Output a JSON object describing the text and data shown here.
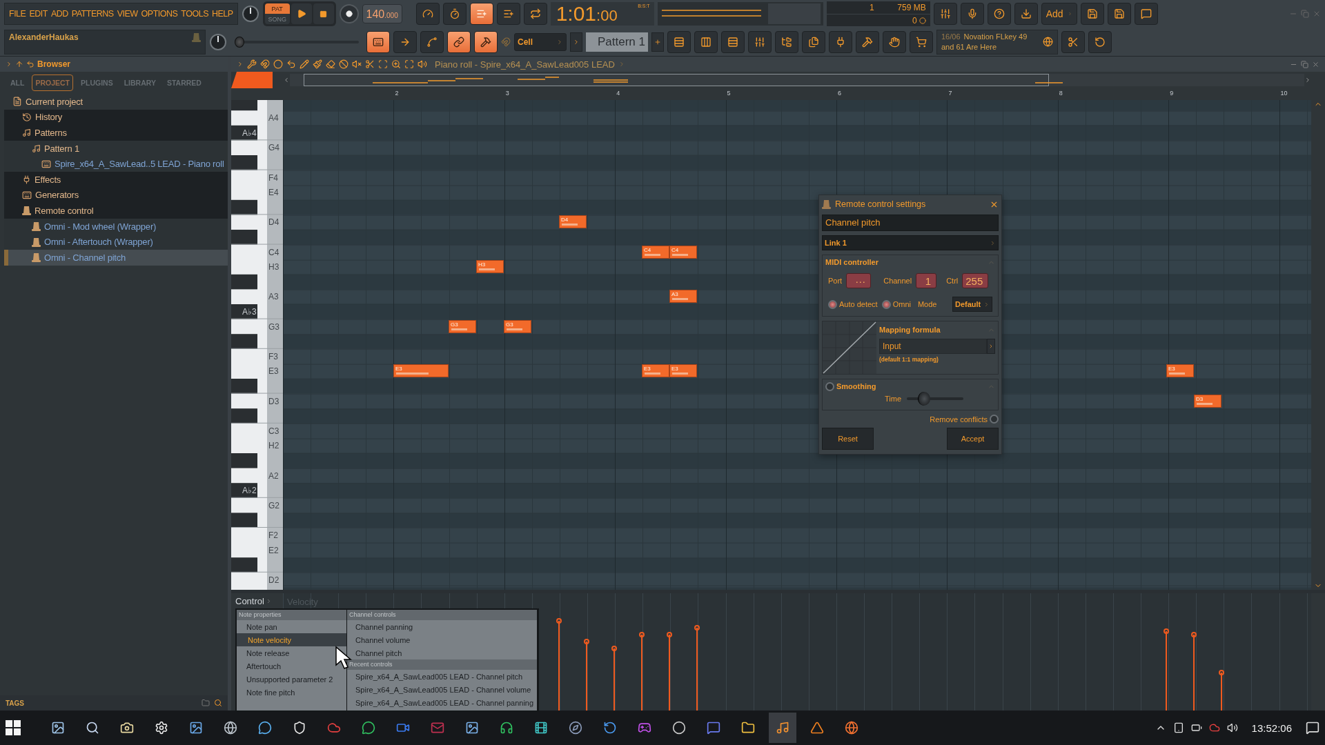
{
  "menu": [
    "FILE",
    "EDIT",
    "ADD",
    "PATTERNS",
    "VIEW",
    "OPTIONS",
    "TOOLS",
    "HELP"
  ],
  "hint_bar": {
    "text": "AlexanderHaukas"
  },
  "transport": {
    "modes": [
      {
        "label": "PAT",
        "selected": true
      },
      {
        "label": "SONG",
        "selected": false
      }
    ],
    "tempo": "140",
    "tempo_fraction": ".000"
  },
  "recording_toggles": [
    {
      "on": false
    },
    {
      "on": false
    },
    {
      "on": true
    },
    {
      "on": false
    },
    {
      "on": false
    }
  ],
  "time": {
    "value": "1:01",
    "ticks": ":00",
    "unit": "B:S:T"
  },
  "monitor": {
    "value": "1",
    "memory": "759 MB",
    "polyphony": "0"
  },
  "add_button": "Add",
  "master_pitch": {
    "level": 0
  },
  "tool_toggles": [
    {
      "on": true
    },
    {
      "on": false
    },
    {
      "on": false
    },
    {
      "on": true
    },
    {
      "on": true
    }
  ],
  "snap": "Cell",
  "pattern": "Pattern 1",
  "news": {
    "date": "16/06",
    "text": "Novation FLkey 49 and 61 Are Here"
  },
  "browser": {
    "title": "Browser",
    "tabs": [
      {
        "label": "ALL",
        "selected": false
      },
      {
        "label": "PROJECT",
        "selected": true
      },
      {
        "label": "PLUGINS",
        "selected": false
      },
      {
        "label": "LIBRARY",
        "selected": false
      },
      {
        "label": "STARRED",
        "selected": false
      }
    ],
    "tree": [
      {
        "label": "Current project",
        "kind": "doc",
        "selected": false,
        "children": [
          {
            "label": "History",
            "kind": "history",
            "selected": false
          },
          {
            "label": "Patterns",
            "kind": "note",
            "selected": false,
            "children": [
              {
                "label": "Pattern 1",
                "kind": "note",
                "selected": false,
                "children": [
                  {
                    "label": "Spire_x64_A_SawLead..5 LEAD - Piano roll",
                    "kind": "piano-item",
                    "selected": false
                  }
                ]
              }
            ]
          },
          {
            "label": "Effects",
            "kind": "effect",
            "selected": false
          },
          {
            "label": "Generators",
            "kind": "piano",
            "selected": false
          },
          {
            "label": "Remote control",
            "kind": "knob",
            "selected": false,
            "children": [
              {
                "label": "Omni - Mod wheel (Wrapper)",
                "kind": "knob-item",
                "selected": false
              },
              {
                "label": "Omni - Aftertouch (Wrapper)",
                "kind": "knob-item",
                "selected": false
              },
              {
                "label": "Omni - Channel pitch",
                "kind": "knob-item",
                "selected": true
              }
            ]
          }
        ]
      }
    ],
    "tags": "TAGS"
  },
  "piano_roll": {
    "title": "Piano roll - Spire_x64_A_SawLead005 LEAD",
    "bars": [
      "2",
      "3",
      "4",
      "5",
      "6",
      "7",
      "8",
      "9",
      "10"
    ],
    "keys": [
      {
        "label": "A4",
        "kind": "white"
      },
      {
        "label": "A♭4",
        "kind": "black"
      },
      {
        "label": "G4",
        "kind": "white"
      },
      {
        "label": "F4",
        "kind": "white"
      },
      {
        "label": "E4",
        "kind": "white"
      },
      {
        "label": "D4",
        "kind": "white"
      },
      {
        "label": "C4",
        "kind": "white"
      },
      {
        "label": "H3",
        "kind": "white"
      },
      {
        "label": "A3",
        "kind": "white"
      },
      {
        "label": "A♭3",
        "kind": "black"
      },
      {
        "label": "G3",
        "kind": "white"
      },
      {
        "label": "F3",
        "kind": "white"
      },
      {
        "label": "E3",
        "kind": "white"
      },
      {
        "label": "D3",
        "kind": "white"
      },
      {
        "label": "C3",
        "kind": "white"
      },
      {
        "label": "H2",
        "kind": "white"
      },
      {
        "label": "A2",
        "kind": "white"
      },
      {
        "label": "A♭2",
        "kind": "black"
      },
      {
        "label": "G2",
        "kind": "white"
      },
      {
        "label": "F2",
        "kind": "white"
      },
      {
        "label": "E2",
        "kind": "white"
      },
      {
        "label": "D2",
        "kind": "white"
      }
    ],
    "notes": [
      {
        "label": "E3"
      },
      {
        "label": "G3"
      },
      {
        "label": "G3"
      },
      {
        "label": "H3"
      },
      {
        "label": "D4"
      },
      {
        "label": "C4"
      },
      {
        "label": "C4"
      },
      {
        "label": "A3"
      },
      {
        "label": "E3"
      },
      {
        "label": "E3"
      },
      {
        "label": "E3"
      },
      {
        "label": "D3"
      }
    ]
  },
  "remote_dialog": {
    "title": "Remote control settings",
    "name": "Channel pitch",
    "link": "Link 1",
    "midi": {
      "title": "MIDI controller",
      "port_label": "Port",
      "port": "···",
      "channel_label": "Channel",
      "channel": "1",
      "ctrl_label": "Ctrl",
      "ctrl": "255",
      "options": [
        {
          "label": "Auto detect",
          "checked": true
        },
        {
          "label": "Omni",
          "checked": true
        }
      ],
      "mode_label": "Mode",
      "mode": "Default"
    },
    "mapping": {
      "title": "Mapping formula",
      "formula": "Input",
      "note": "(default 1:1 mapping)"
    },
    "smoothing": {
      "label": "Smoothing",
      "checked": false,
      "time_label": "Time",
      "level": 0.25
    },
    "remove_conflicts": {
      "label": "Remove conflicts",
      "checked": false
    },
    "buttons": [
      "Reset",
      "Accept"
    ]
  },
  "event_editor": {
    "control": "Control",
    "target": "Velocity",
    "menu": [
      {
        "title": "Note properties",
        "items": [
          {
            "label": "Note pan",
            "selected": false
          },
          {
            "label": "Note velocity",
            "selected": true
          },
          {
            "label": "Note release",
            "selected": false
          },
          {
            "label": "Aftertouch",
            "selected": false
          },
          {
            "label": "Unsupported parameter 2",
            "selected": false
          },
          {
            "label": "Note fine pitch",
            "selected": false
          }
        ]
      },
      {
        "title": "Channel controls",
        "items": [
          {
            "label": "Channel panning",
            "selected": false
          },
          {
            "label": "Channel volume",
            "selected": false
          },
          {
            "label": "Channel pitch",
            "selected": false
          }
        ]
      },
      {
        "title": "Recent controls",
        "items": [
          {
            "label": "Spire_x64_A_SawLead005 LEAD - Channel pitch",
            "selected": false
          },
          {
            "label": "Spire_x64_A_SawLead005 LEAD - Channel volume",
            "selected": false
          },
          {
            "label": "Spire_x64_A_SawLead005 LEAD - Channel panning",
            "selected": false
          }
        ]
      }
    ]
  },
  "taskbar": {
    "time": "13:52:06"
  }
}
